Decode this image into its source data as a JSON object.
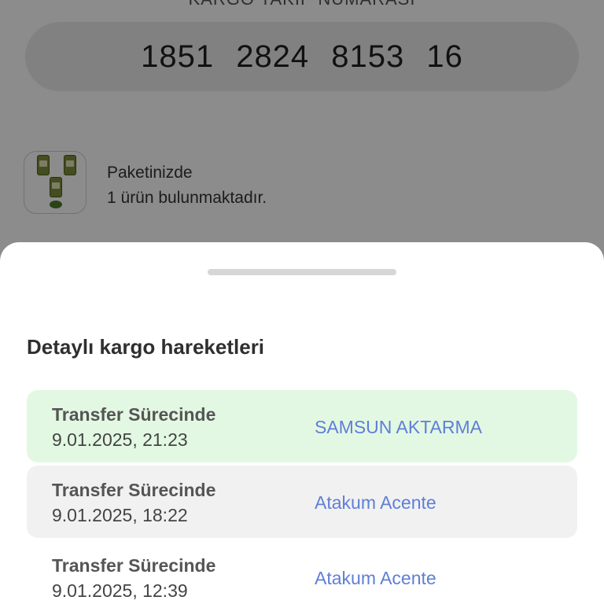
{
  "tracking": {
    "caption": "KARGO TAKİP NUMARASI",
    "number": "1851  2824  8153  16"
  },
  "package": {
    "line1": "Paketinizde",
    "line2": "1 ürün bulunmaktadır."
  },
  "sheet": {
    "title": "Detaylı kargo hareketleri",
    "moves": [
      {
        "status": "Transfer Sürecinde",
        "time": "9.01.2025, 21:23",
        "location": "SAMSUN AKTARMA"
      },
      {
        "status": "Transfer Sürecinde",
        "time": "9.01.2025, 18:22",
        "location": "Atakum Acente"
      },
      {
        "status": "Transfer Sürecinde",
        "time": "9.01.2025, 12:39",
        "location": "Atakum Acente"
      }
    ]
  },
  "colors": {
    "active_row": "#e3f8e3",
    "alt_row": "#f1f1f1",
    "location_link": "#5f7fd6"
  }
}
